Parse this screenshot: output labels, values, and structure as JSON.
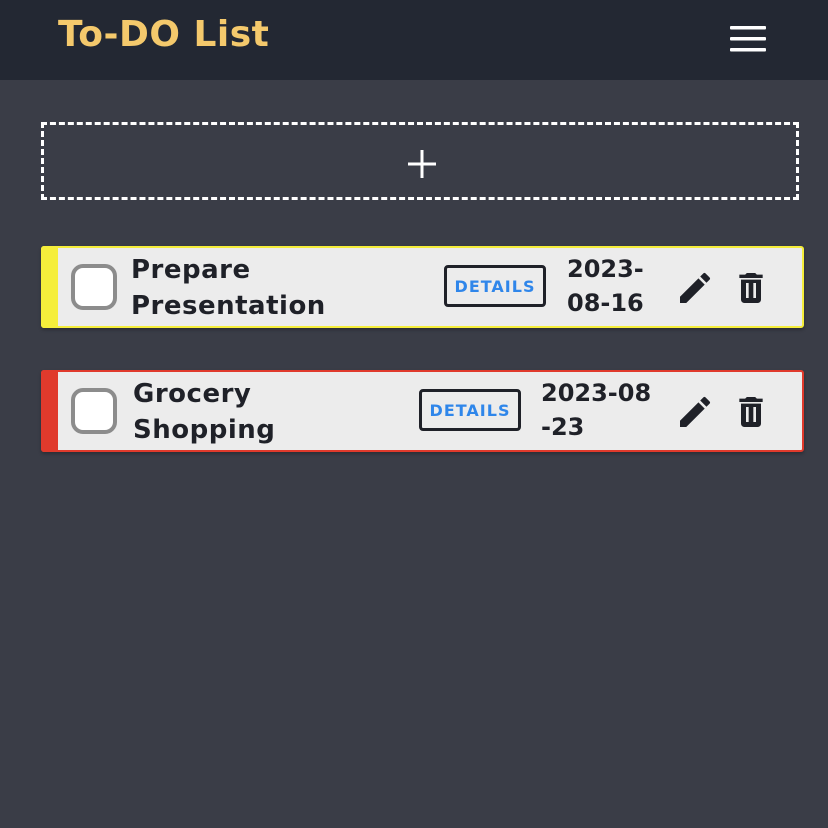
{
  "header": {
    "title": "To-DO List",
    "menu_icon": "hamburger-menu-icon",
    "title_color": "#f4c96c",
    "background_color": "#232833"
  },
  "add_task": {
    "icon": "plus-icon"
  },
  "tasks": [
    {
      "title": "Prepare Presentation",
      "details_label": "DETAILS",
      "due_date": "2023-08-16",
      "priority_color": "#f5ee3b",
      "completed": false,
      "edit_icon": "pencil-icon",
      "delete_icon": "trash-icon"
    },
    {
      "title": "Grocery Shopping",
      "details_label": "DETAILS",
      "due_date": "2023-08-23",
      "priority_color": "#e03a2c",
      "completed": false,
      "edit_icon": "pencil-icon",
      "delete_icon": "trash-icon"
    }
  ],
  "colors": {
    "page_background": "#3a3d47",
    "card_background": "#ececec",
    "details_text": "#2f86ea"
  }
}
